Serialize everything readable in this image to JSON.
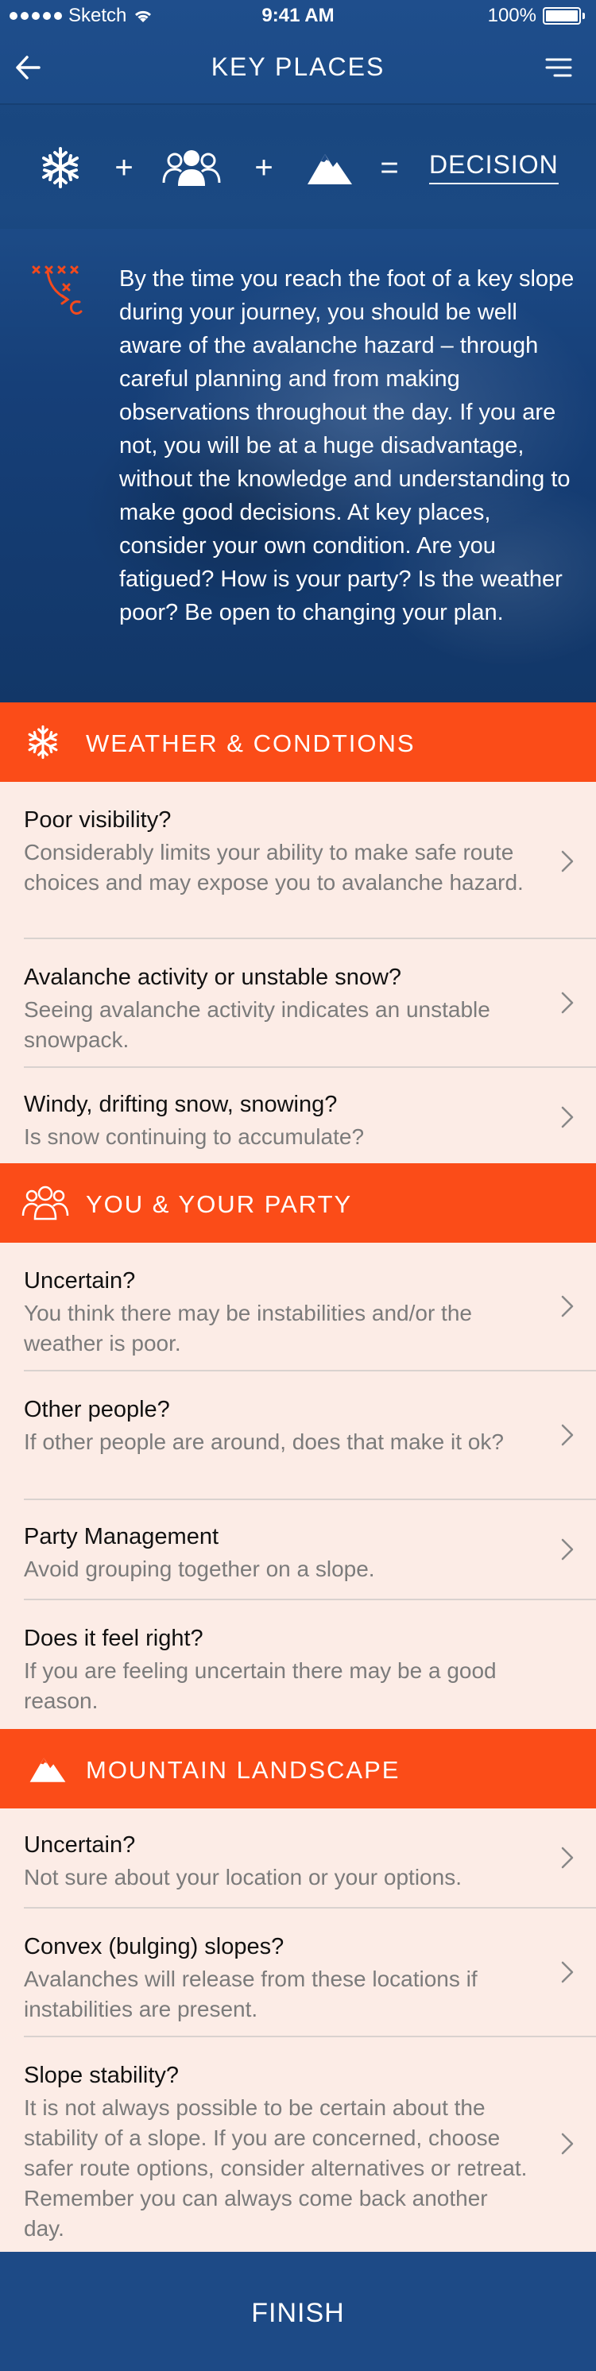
{
  "status": {
    "carrier": "Sketch",
    "time": "9:41 AM",
    "battery": "100%"
  },
  "nav": {
    "title": "KEY PLACES",
    "back_icon": "arrow-left-icon",
    "menu_icon": "hamburger-menu-icon"
  },
  "equation": {
    "items": [
      "snowflake-icon",
      "group-icon",
      "mountain-icon"
    ],
    "plus": "+",
    "equals": "=",
    "result": "DECISION"
  },
  "intro": {
    "icon": "tactics-plan-icon",
    "text": "By the time you reach the foot of a key slope during your journey, you should be well aware of the avalanche hazard – through careful planning and from making observations throughout the day. If you are not, you will be at a huge disadvantage, without the knowledge and understanding to make good decisions. At key places, consider your own condition. Are you fatigued? How is your party? Is the weather poor? Be open to changing your plan."
  },
  "sections": [
    {
      "title": "WEATHER & CONDTIONS",
      "icon": "snowflake-icon",
      "items": [
        {
          "title": "Poor visibility?",
          "desc": "Considerably limits your ability to make safe route choices and may expose you to avalanche hazard."
        },
        {
          "title": "Avalanche activity or unstable snow?",
          "desc": "Seeing avalanche activity indicates an unstable snowpack."
        },
        {
          "title": "Windy, drifting snow, snowing?",
          "desc": "Is snow continuing to accumulate?"
        }
      ]
    },
    {
      "title": "YOU & YOUR PARTY",
      "icon": "group-icon",
      "items": [
        {
          "title": "Uncertain?",
          "desc": "You think there may be instabilities and/or the weather is poor."
        },
        {
          "title": "Other people?",
          "desc": "If other people are around, does that make it ok?"
        },
        {
          "title": "Party Management",
          "desc": "Avoid grouping together on a slope."
        },
        {
          "title": "Does it feel right?",
          "desc": "If you are feeling uncertain there may be a good reason."
        }
      ]
    },
    {
      "title": "MOUNTAIN LANDSCAPE",
      "icon": "mountain-icon",
      "items": [
        {
          "title": "Uncertain?",
          "desc": "Not sure about your location or your options."
        },
        {
          "title": "Convex (bulging) slopes?",
          "desc": "Avalanches will release from these locations if instabilities are present."
        },
        {
          "title": "Slope stability?",
          "desc": "It is not always possible to be certain about the stability of a slope. If you are concerned, choose safer route options, consider alternatives or retreat. Remember you can always come back another day."
        }
      ]
    }
  ],
  "finish": {
    "label": "FINISH"
  },
  "colors": {
    "navy": "#1d4a86",
    "accent": "#fb4c18",
    "row_bg": "#fcece6"
  }
}
